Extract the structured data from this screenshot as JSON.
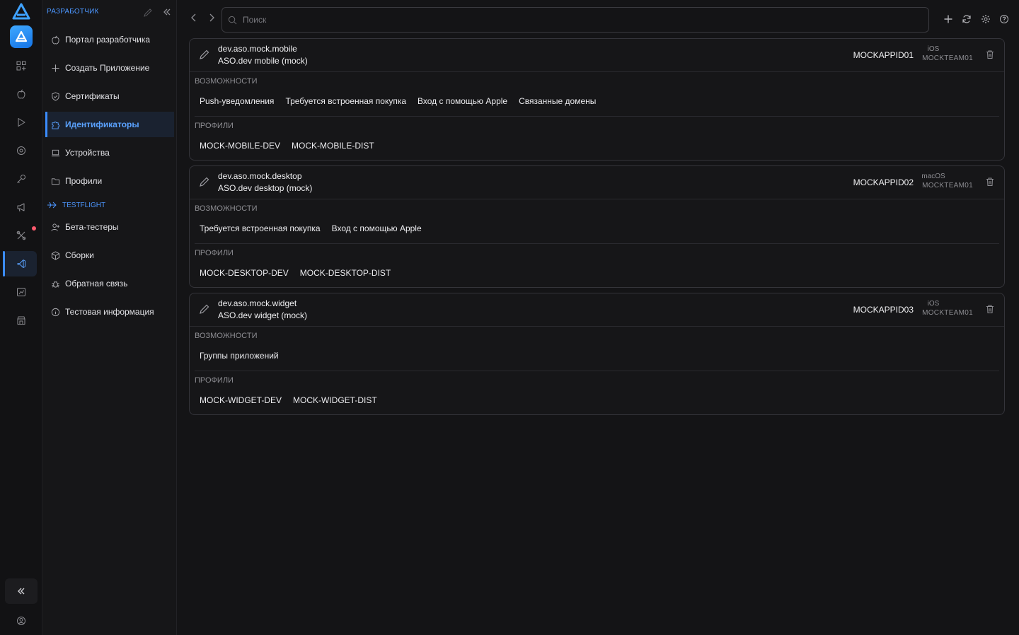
{
  "sidebar": {
    "header": "РАЗРАБОТЧИК",
    "items": [
      {
        "label": "Портал разработчика",
        "icon": "apple-icon"
      },
      {
        "label": "Создать Приложение",
        "icon": "plus-icon"
      },
      {
        "label": "Сертификаты",
        "icon": "shield-check-icon"
      },
      {
        "label": "Идентификаторы",
        "icon": "puzzle-icon",
        "active": true
      },
      {
        "label": "Устройства",
        "icon": "laptop-icon"
      },
      {
        "label": "Профили",
        "icon": "folder-icon"
      }
    ],
    "section_testflight": "TESTFLIGHT",
    "testflight_items": [
      {
        "label": "Бета-тестеры",
        "icon": "user-plus-icon"
      },
      {
        "label": "Сборки",
        "icon": "package-icon"
      },
      {
        "label": "Обратная связь",
        "icon": "bug-icon"
      },
      {
        "label": "Тестовая информация",
        "icon": "info-icon"
      }
    ]
  },
  "search": {
    "placeholder": "Поиск"
  },
  "sections": {
    "capabilities": "ВОЗМОЖНОСТИ",
    "profiles": "ПРОФИЛИ"
  },
  "identifiers": [
    {
      "bundle_id": "dev.aso.mock.mobile",
      "name": "ASO.dev mobile (mock)",
      "app_id": "MOCKAPPID01",
      "platform": "iOS",
      "team": "MOCKTEAM01",
      "capabilities": [
        "Push-уведомления",
        "Требуется встроенная покупка",
        "Вход с помощью Apple",
        "Связанные домены"
      ],
      "profiles": [
        "MOCK-MOBILE-DEV",
        "MOCK-MOBILE-DIST"
      ]
    },
    {
      "bundle_id": "dev.aso.mock.desktop",
      "name": "ASO.dev desktop (mock)",
      "app_id": "MOCKAPPID02",
      "platform": "macOS",
      "team": "MOCKTEAM01",
      "capabilities": [
        "Требуется встроенная покупка",
        "Вход с помощью Apple"
      ],
      "profiles": [
        "MOCK-DESKTOP-DEV",
        "MOCK-DESKTOP-DIST"
      ]
    },
    {
      "bundle_id": "dev.aso.mock.widget",
      "name": "ASO.dev widget (mock)",
      "app_id": "MOCKAPPID03",
      "platform": "iOS",
      "team": "MOCKTEAM01",
      "capabilities": [
        "Группы приложений"
      ],
      "profiles": [
        "MOCK-WIDGET-DEV",
        "MOCK-WIDGET-DIST"
      ]
    }
  ],
  "colors": {
    "accent": "#3b8cff",
    "background": "#141416",
    "notification": "#ff5a6e"
  }
}
